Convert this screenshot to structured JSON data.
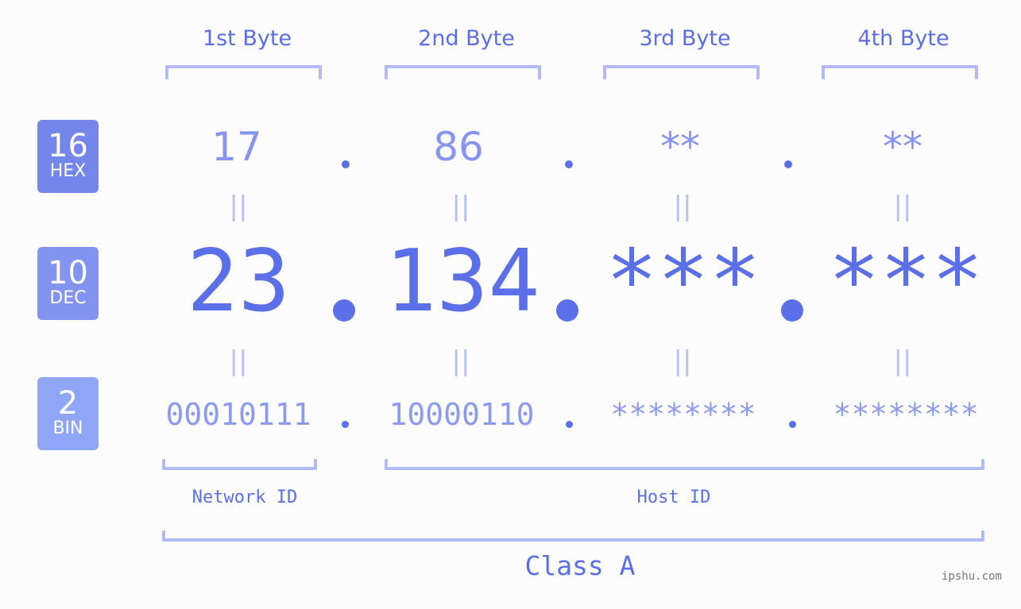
{
  "headers": [
    "1st Byte",
    "2nd Byte",
    "3rd Byte",
    "4th Byte"
  ],
  "badges": [
    {
      "num": "16",
      "label": "HEX",
      "color": "#7486ec"
    },
    {
      "num": "10",
      "label": "DEC",
      "color": "#8393f0"
    },
    {
      "num": "2",
      "label": "BIN",
      "color": "#8fa6f7"
    }
  ],
  "hex": [
    "17",
    "86",
    "**",
    "**"
  ],
  "dec": [
    "23",
    "134",
    "***",
    "***"
  ],
  "bin": [
    "00010111",
    "10000110",
    "********",
    "********"
  ],
  "equals_symbol": "||",
  "segments": {
    "network": "Network ID",
    "host": "Host ID"
  },
  "class_label": "Class A",
  "watermark": "ipshu.com"
}
